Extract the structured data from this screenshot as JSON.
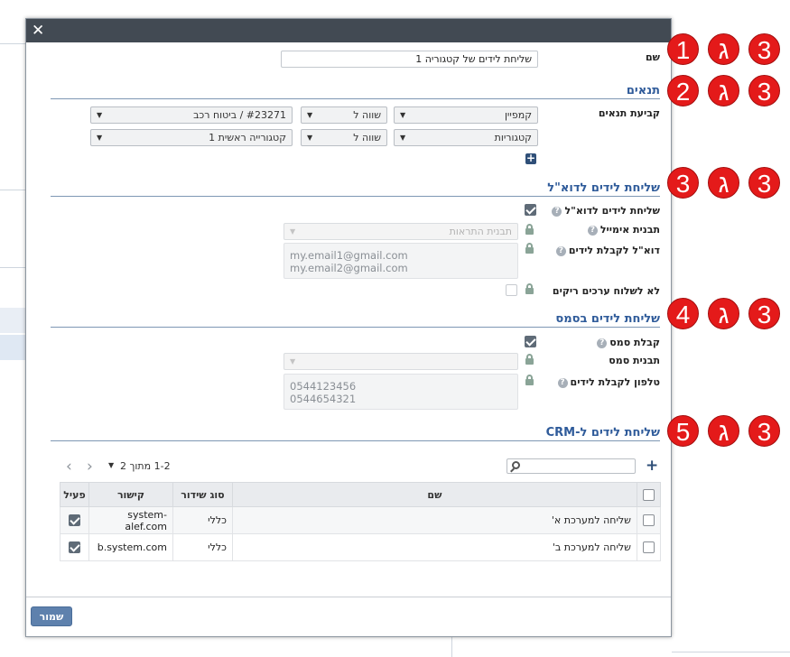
{
  "dialog": {
    "close_glyph": "✕"
  },
  "name_field": {
    "label": "שם",
    "value": "שליחת לידים של קטגוריה 1"
  },
  "conditions": {
    "title": "תנאים",
    "label": "קביעת תנאים",
    "rows": [
      {
        "field": "קמפיין",
        "operator": "שווה ל",
        "value": "#23271 / ביטוח רכב"
      },
      {
        "field": "קטגוריות",
        "operator": "שווה ל",
        "value": "קטגורייה ראשית 1"
      }
    ],
    "add_glyph": "+"
  },
  "email_section": {
    "title": "שליחת לידים לדוא\"ל",
    "send_label": "שליחת לידים לדוא\"ל",
    "send_checked": true,
    "template_label": "תבנית אימייל",
    "template_placeholder": "תבנית התראות",
    "recipients_label": "דוא\"ל לקבלת לידים",
    "recipients": [
      "my.email1@gmail.com",
      "my.email2@gmail.com"
    ],
    "no_empty_label": "לא לשלוח ערכים ריקים",
    "no_empty_checked": false
  },
  "sms_section": {
    "title": "שליחת לידים בסמס",
    "receive_label": "קבלת סמס",
    "receive_checked": true,
    "template_label": "תבנית סמס",
    "phones_label": "טלפון לקבלת לידים",
    "phones": [
      "0544123456",
      "0544654321"
    ]
  },
  "crm_section": {
    "title": "שליחת לידים ל-CRM",
    "add_glyph": "+",
    "pager": "1-2 מתוך 2",
    "columns": {
      "name": "שם",
      "type": "סוג שידור",
      "link": "קישור",
      "active": "פעיל"
    },
    "rows": [
      {
        "name": "שליחה למערכת א'",
        "type": "כללי",
        "link": "system-alef.com",
        "active": true
      },
      {
        "name": "שליחה למערכת ב'",
        "type": "כללי",
        "link": "b.system.com",
        "active": true
      }
    ]
  },
  "footer": {
    "save_label": "שמור"
  },
  "annotations": [
    {
      "number": "1",
      "letter": "ג",
      "section": "3"
    },
    {
      "number": "2",
      "letter": "ג",
      "section": "3"
    },
    {
      "number": "3",
      "letter": "ג",
      "section": "3"
    },
    {
      "number": "4",
      "letter": "ג",
      "section": "3"
    },
    {
      "number": "5",
      "letter": "ג",
      "section": "3"
    }
  ],
  "colors": {
    "titlebar": "#424a53",
    "section_title": "#2f5b9a",
    "save_button": "#5e81ad",
    "badge": "#e41a1a"
  }
}
